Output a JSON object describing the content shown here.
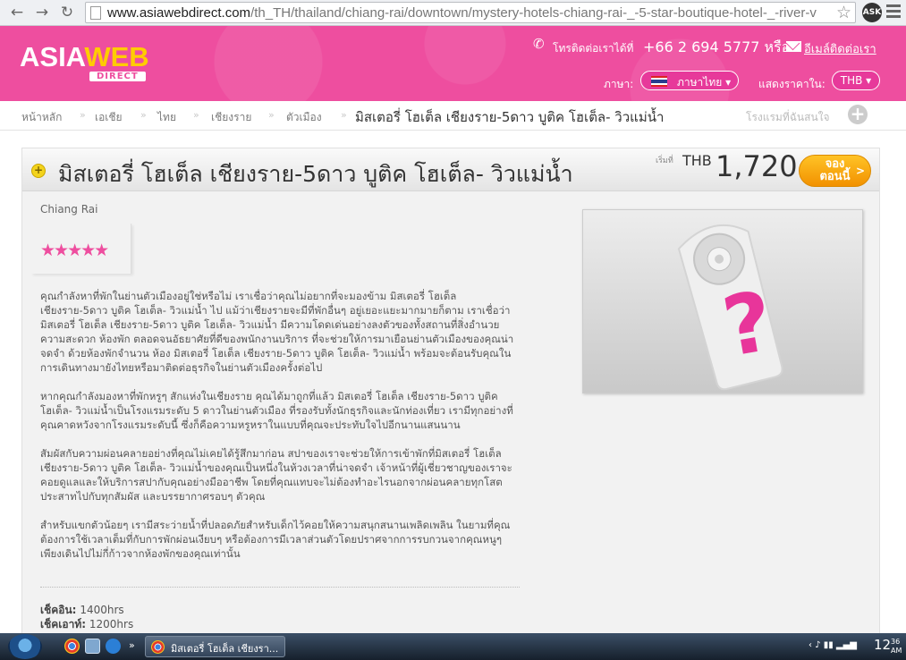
{
  "browser": {
    "url_host": "www.asiawebdirect.com",
    "url_path": "/th_TH/thailand/chiang-rai/downtown/mystery-hotels-chiang-rai-_-5-star-boutique-hotel-_-river-v",
    "ask_label": "ASK"
  },
  "header": {
    "logo_asia": "ASIA",
    "logo_web": "WEB",
    "logo_direct": "DIRECT",
    "call_label": "โทรติดต่อเราได้ที่",
    "call_number": "+66 2 694 5777 หรือ",
    "email_link": "อีเมล์ติดต่อเรา",
    "language_label": "ภาษา:",
    "language_value": "ภาษาไทย ▾",
    "price_label": "แสดงราคาใน:",
    "currency_value": "THB ▾"
  },
  "breadcrumb": {
    "items": [
      "หน้าหลัก",
      "เอเชีย",
      "ไทย",
      "เชียงราย",
      "ตัวเมือง"
    ],
    "current": "มิสเตอรี่ โฮเต็ล เชียงราย-5ดาว บูติค โฮเต็ล- วิวแม่น้ำ",
    "interest": "โรงแรมที่ฉันสนใจ"
  },
  "hotel": {
    "title": "มิสเตอรี่ โฮเต็ล เชียงราย-5ดาว บูติค โฮเต็ล- วิวแม่น้ำ",
    "from_label": "เริ่มที่",
    "currency": "THB",
    "price": "1,720",
    "book_line1": "จอง",
    "book_line2": "ตอนนี้",
    "city": "Chiang Rai",
    "stars": "★★★★★",
    "rating": 5,
    "description": [
      "คุณกำลังหาที่พักในย่านตัวเมืองอยู่ใช่หรือไม่ เราเชื่อว่าคุณไม่อยากที่จะมองข้าม มิสเตอรี่ โฮเต็ล เชียงราย-5ดาว บูติค โฮเต็ล- วิวแม่น้ำ ไป แม้ว่าเชียงรายจะมีที่พักอื่นๆ อยู่เยอะแยะมากมายก็ตาม เราเชื่อว่า มิสเตอรี่ โฮเต็ล เชียงราย-5ดาว บูติค โฮเต็ล- วิวแม่น้ำ มีความโดดเด่นอย่างลงตัวของทั้งสถานที่สิ่งอำนวยความสะดวก ห้องพัก ตลอดจนอัธยาศัยที่ดีของพนักงานบริการ ที่จะช่วยให้การมาเยือนย่านตัวเมืองของคุณน่าจดจำ ด้วยห้องพักจำนวน ห้อง มิสเตอรี่ โฮเต็ล เชียงราย-5ดาว บูติค โฮเต็ล- วิวแม่น้ำ พร้อมจะต้อนรับคุณในการเดินทางมายังไทยหรือมาติดต่อธุรกิจในย่านตัวเมืองครั้งต่อไป",
      "หากคุณกำลังมองหาที่พักหรูๆ สักแห่งในเชียงราย คุณได้มาถูกที่แล้ว มิสเตอรี่ โฮเต็ล เชียงราย-5ดาว บูติค โฮเต็ล- วิวแม่น้ำเป็นโรงแรมระดับ 5 ดาวในย่านตัวเมือง ที่รองรับทั้งนักธุรกิจและนักท่องเที่ยว เรามีทุกอย่างที่คุณคาดหวังจากโรงแรมระดับนี้ ซึ่งก็คือความหรูหราในแบบที่คุณจะประทับใจไปอีกนานแสนนาน",
      "สัมผัสกับความผ่อนคลายอย่างที่คุณไม่เคยได้รู้สึกมาก่อน สปาของเราจะช่วยให้การเข้าพักที่มิสเตอรี่ โฮเต็ล เชียงราย-5ดาว บูติค โฮเต็ล- วิวแม่น้ำของคุณเป็นหนึ่งในห้วงเวลาที่น่าจดจำ เจ้าหน้าที่ผู้เชี่ยวชาญของเราจะคอยดูแลและให้บริการสปากับคุณอย่างมืออาชีพ โดยที่คุณแทบจะไม่ต้องทำอะไรนอกจากผ่อนคลายทุกโสตประสาทไปกับทุกสัมผัส และบรรยากาศรอบๆ ตัวคุณ",
      "สำหรับแขกตัวน้อยๆ เรามีสระว่ายน้ำที่ปลอดภัยสำหรับเด็กไว้คอยให้ความสนุกสนานเพลิดเพลิน ในยามที่คุณต้องการใช้เวลาเต็มที่กับการพักผ่อนเงียบๆ หรือต้องการมีเวลาส่วนตัวโดยปราศจากการรบกวนจากคุณหนูๆ เพียงเดินไปไม่กี่ก้าวจากห้องพักของคุณเท่านั้น"
    ],
    "checkin_label": "เช็คอิน:",
    "checkin_value": "1400hrs",
    "checkout_label": "เช็คเอาท์:",
    "checkout_value": "1200hrs"
  },
  "taskbar": {
    "task_label": "มิสเตอรี่ โฮเต็ล เชียงรา...",
    "clock": "12",
    "clock_small": "36",
    "clock_ampm": "AM"
  },
  "colors": {
    "brand_pink": "#ee4e9f",
    "brand_yellow": "#ffcc00",
    "book_orange": "#f29100"
  }
}
